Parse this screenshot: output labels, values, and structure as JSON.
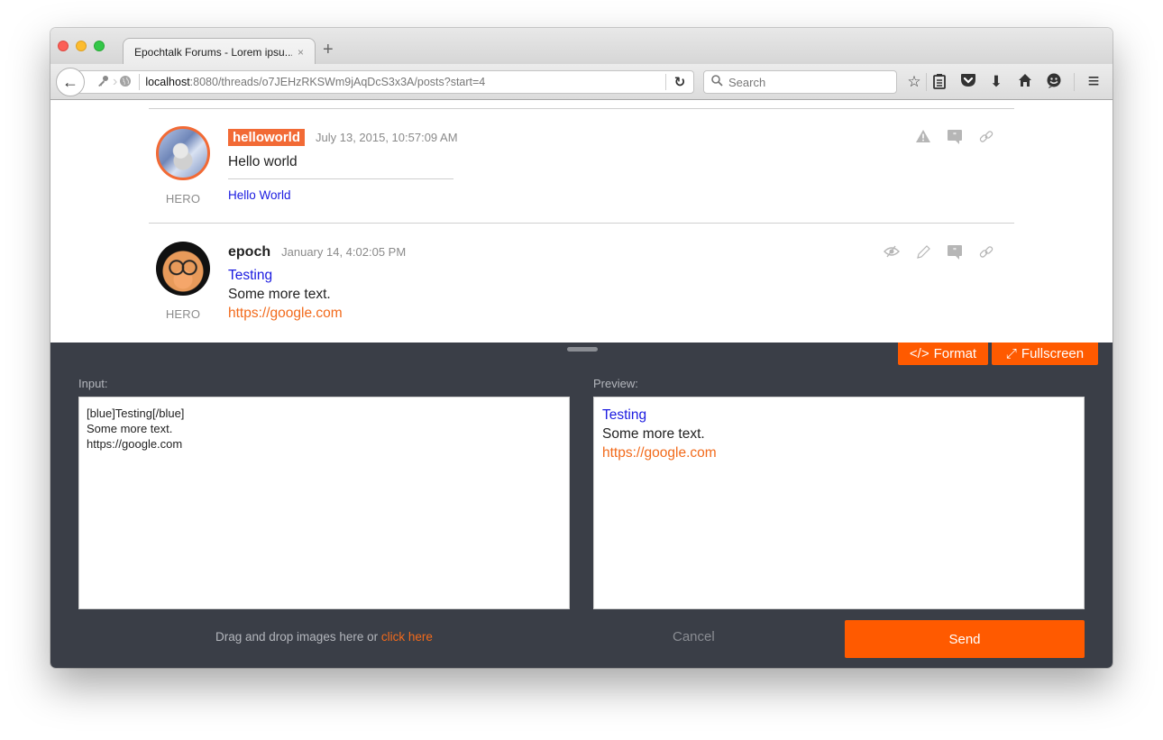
{
  "browser": {
    "tab_title": "Epochtalk Forums - Lorem ipsu...",
    "tab_close_icon": "×",
    "new_tab_icon": "+",
    "url_host": "localhost",
    "url_rest": ":8080/threads/o7JEHzRKSWm9jAqDcS3x3A/posts?start=4",
    "search_placeholder": "Search",
    "icons": {
      "back": "←",
      "key": "🔑",
      "globe": "◍",
      "reload": "↻",
      "search": "⌕",
      "bookmark_star": "☆",
      "reading_list": "▤",
      "pocket": "⛉",
      "download": "⬇",
      "home": "⌂",
      "hello": "☻",
      "menu": "≡"
    }
  },
  "posts": [
    {
      "username": "helloworld",
      "username_highlighted": true,
      "timestamp": "July 13, 2015, 10:57:09 AM",
      "rank": "HERO",
      "avatar": "astronaut-avatar",
      "body_lines": [
        "Hello world"
      ],
      "signature": "Hello World",
      "actions": [
        {
          "name": "report-icon",
          "glyph": "▲"
        },
        {
          "name": "quote-icon",
          "glyph": "❞"
        },
        {
          "name": "permalink-icon",
          "glyph": "🔗"
        }
      ]
    },
    {
      "username": "epoch",
      "username_highlighted": false,
      "timestamp": "January 14, 4:02:05 PM",
      "rank": "HERO",
      "avatar": "cat-avatar",
      "body_blue": "Testing",
      "body_text": "Some more text.",
      "body_link": "https://google.com",
      "actions": [
        {
          "name": "hide-icon",
          "glyph": "◎"
        },
        {
          "name": "edit-icon",
          "glyph": "✎"
        },
        {
          "name": "quote-icon",
          "glyph": "❞"
        },
        {
          "name": "permalink-icon",
          "glyph": "🔗"
        }
      ]
    }
  ],
  "editor": {
    "format_icon": "</>",
    "format_label": "Format",
    "fullscreen_icon": "⤢",
    "fullscreen_label": "Fullscreen",
    "input_label": "Input:",
    "preview_label": "Preview:",
    "input_value": "[blue]Testing[/blue]\nSome more text.\nhttps://google.com",
    "preview": {
      "blue": "Testing",
      "text": "Some more text.",
      "link": "https://google.com"
    },
    "drop_text": "Drag and drop images here or ",
    "drop_link": "click here",
    "cancel_label": "Cancel",
    "send_label": "Send"
  },
  "colors": {
    "accent": "#ff5a00",
    "username_badge": "#f26a35",
    "editor_bg": "#3a3e47",
    "blue_text": "#1a1ae0"
  }
}
